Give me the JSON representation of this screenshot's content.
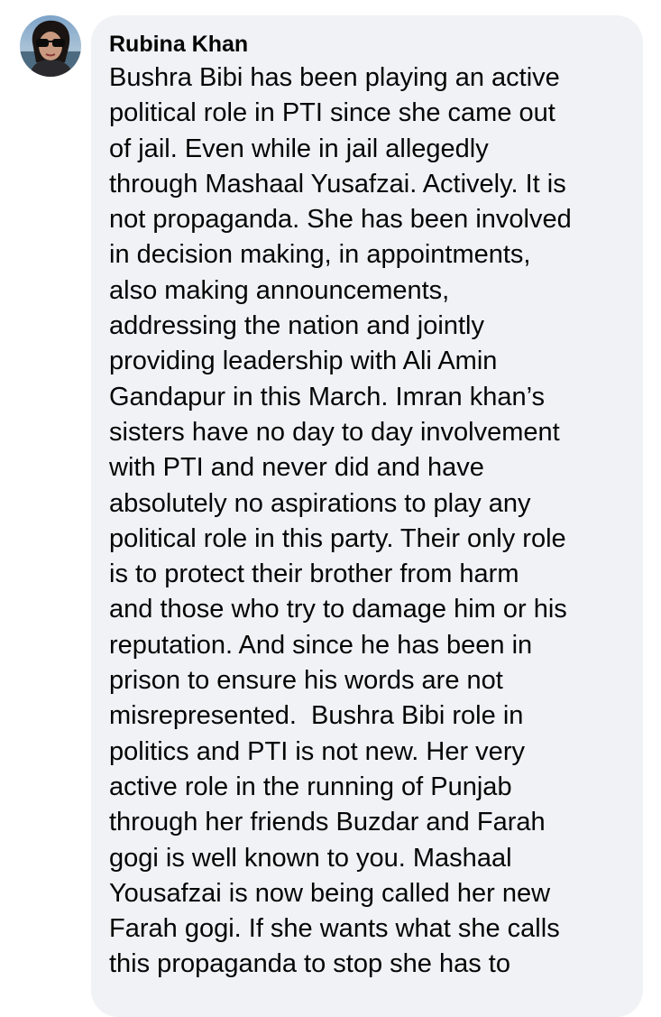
{
  "comment": {
    "author": "Rubina Khan",
    "lines": [
      "Bushra Bibi has been playing an active",
      "political role in PTI since she came out",
      "of jail. Even while in jail allegedly",
      "through Mashaal Yusafzai. Actively. It is",
      "not propaganda. She has been involved",
      "in decision making, in appointments,",
      "also making announcements,",
      "addressing the nation and jointly",
      "providing leadership with Ali Amin",
      "Gandapur in this March. Imran khan’s",
      "sisters have no day to day involvement",
      "with PTI and never did and have",
      "absolutely no aspirations to play any",
      "political role in this party. Their only role",
      "is to protect their brother from harm",
      "and those who try to damage him or his",
      "reputation. And since he has been in",
      "prison to ensure his words are not",
      "misrepresented.  Bushra Bibi role in",
      "politics and PTI is not new. Her very",
      "active role in the running of Punjab",
      "through her friends Buzdar and Farah",
      "gogi is well known to you. Mashaal",
      "Yousafzai is now being called her new",
      "Farah gogi. If she wants what she calls",
      "this propaganda to stop she has to"
    ]
  },
  "colors": {
    "bubble_background": "#f0f2f5",
    "text": "#050505"
  }
}
